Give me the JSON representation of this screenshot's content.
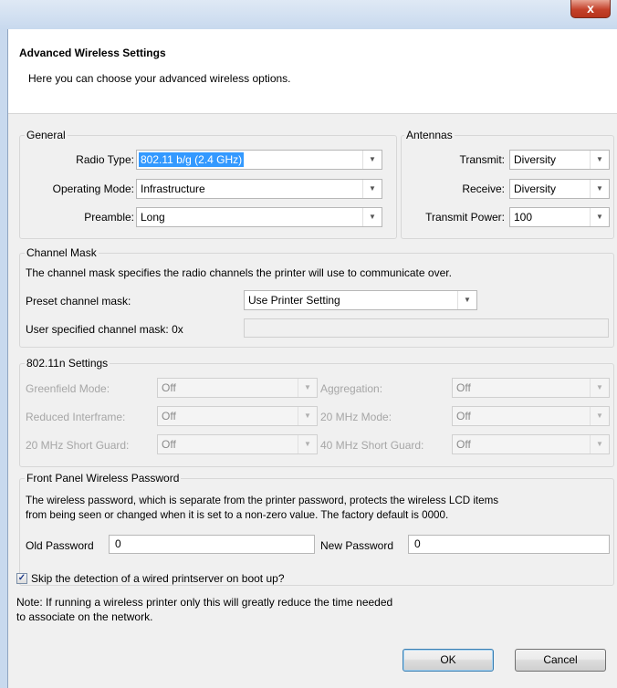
{
  "window": {
    "close_label": "x"
  },
  "header": {
    "title": "Advanced Wireless Settings",
    "subtitle": "Here you can choose your advanced wireless options."
  },
  "general": {
    "legend": "General",
    "radio_type_label": "Radio Type:",
    "radio_type_value": "802.11 b/g (2.4 GHz)",
    "operating_mode_label": "Operating Mode:",
    "operating_mode_value": "Infrastructure",
    "preamble_label": "Preamble:",
    "preamble_value": "Long"
  },
  "antennas": {
    "legend": "Antennas",
    "transmit_label": "Transmit:",
    "transmit_value": "Diversity",
    "receive_label": "Receive:",
    "receive_value": "Diversity",
    "transmit_power_label": "Transmit Power:",
    "transmit_power_value": "100"
  },
  "channel_mask": {
    "legend": "Channel Mask",
    "description": "The channel mask specifies the radio channels the printer will use to communicate over.",
    "preset_label": "Preset channel mask:",
    "preset_value": "Use Printer Setting",
    "user_label": "User specified channel mask: 0x",
    "user_value": ""
  },
  "n_settings": {
    "legend": "802.11n Settings",
    "greenfield_label": "Greenfield Mode:",
    "greenfield_value": "Off",
    "aggregation_label": "Aggregation:",
    "aggregation_value": "Off",
    "reduced_interframe_label": "Reduced Interframe:",
    "reduced_interframe_value": "Off",
    "mode20_label": "20 MHz Mode:",
    "mode20_value": "Off",
    "short_guard20_label": "20 MHz Short Guard:",
    "short_guard20_value": "Off",
    "short_guard40_label": "40 MHz Short Guard:",
    "short_guard40_value": "Off"
  },
  "front_panel": {
    "legend": "Front Panel Wireless Password",
    "description_line1": "The wireless password, which is separate from the printer password, protects the wireless LCD items",
    "description_line2": "from being seen or changed when it is set to a non-zero value. The factory default is 0000.",
    "old_password_label": "Old Password",
    "old_password_value": "0",
    "new_password_label": "New Password",
    "new_password_value": "0"
  },
  "skip_detection": {
    "checked": true,
    "check_glyph": "✓",
    "label": "Skip the detection of a wired printserver on boot up?"
  },
  "note": {
    "line1": "Note: If running a wireless printer only this will greatly reduce the time needed",
    "line2": "to associate on the network."
  },
  "buttons": {
    "ok_label": "OK",
    "cancel_label": "Cancel"
  },
  "icons": {
    "dropdown_arrow": "▼"
  }
}
